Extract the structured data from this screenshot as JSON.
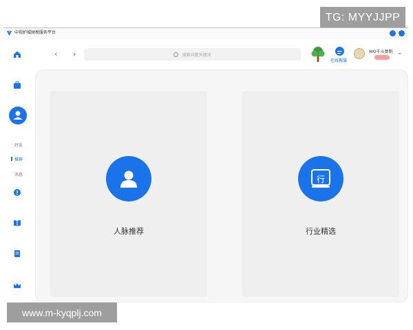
{
  "watermark_top": "TG: MYYJJPP",
  "watermark_bottom": "www.m-kyqplj.com",
  "app": {
    "title": "中视护城财税服务平台"
  },
  "sidebar": {
    "sub_items": [
      {
        "label": "好友"
      },
      {
        "label": "推荐"
      },
      {
        "label": "消息"
      }
    ]
  },
  "topbar": {
    "search_placeholder": "搜索问题关键词",
    "service_label": "在线客服",
    "user_name": "WO千斗复制"
  },
  "cards": [
    {
      "label": "人脉推荐",
      "icon": "person-icon"
    },
    {
      "label": "行业精选",
      "icon": "industry-icon",
      "glyph": "行"
    }
  ],
  "colors": {
    "accent": "#1a73e8"
  }
}
